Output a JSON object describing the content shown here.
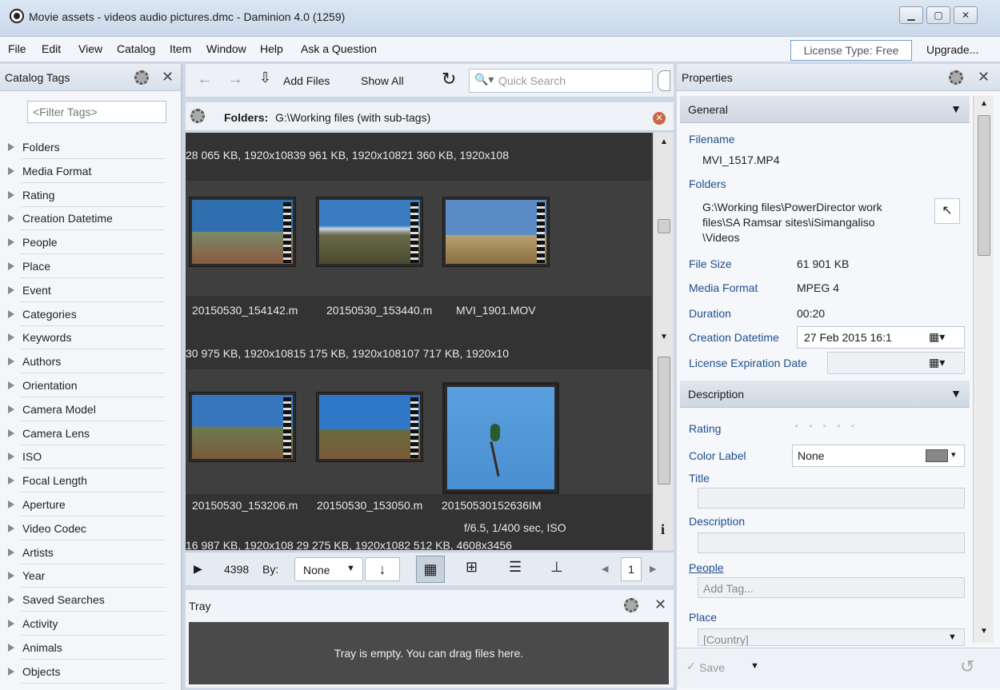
{
  "window": {
    "title": "Movie assets - videos audio pictures.dmc - Daminion 4.0 (1259)"
  },
  "menu": {
    "items": [
      "File",
      "Edit",
      "View",
      "Catalog",
      "Item",
      "Window",
      "Help",
      "Ask a Question"
    ],
    "license": "License Type: Free",
    "upgrade": "Upgrade..."
  },
  "left_panel": {
    "title": "Catalog Tags",
    "filter_placeholder": "<Filter Tags>",
    "tags": [
      "Folders",
      "Media Format",
      "Rating",
      "Creation Datetime",
      "People",
      "Place",
      "Event",
      "Categories",
      "Keywords",
      "Authors",
      "Orientation",
      "Camera Model",
      "Camera Lens",
      "ISO",
      "Focal Length",
      "Aperture",
      "Video Codec",
      "Artists",
      "Year",
      "Saved Searches",
      "Activity",
      "Animals",
      "Objects"
    ]
  },
  "toolbar": {
    "add_files": "Add Files",
    "show_all": "Show All",
    "search_placeholder": "Quick Search"
  },
  "folderbar": {
    "label": "Folders:",
    "path": "G:\\Working files (with sub-tags)"
  },
  "grid": {
    "row1_top": "28 065 KB, 1920x10839 961 KB, 1920x10821 360 KB, 1920x108",
    "row1_names": [
      "20150530_154142.m",
      "20150530_153440.m",
      "MVI_1901.MOV"
    ],
    "row2_top": "30 975 KB, 1920x10815 175 KB, 1920x108107 717 KB, 1920x10",
    "row2_names": [
      "20150530_153206.m",
      "20150530_153050.m",
      "20150530152636IM"
    ],
    "row2_extra": "f/6.5, 1/400 sec, ISO",
    "row3_top": "16 987 KB, 1920x108 29 275 KB, 1920x1082 512 KB, 4608x3456"
  },
  "bottom": {
    "count": "4398",
    "by": "By:",
    "sort": "None",
    "page": "1"
  },
  "tray": {
    "title": "Tray",
    "empty": "Tray is empty. You can drag files here."
  },
  "properties": {
    "title": "Properties",
    "general": "General",
    "filename_label": "Filename",
    "filename": "MVI_1517.MP4",
    "folders_label": "Folders",
    "folders_value": "G:\\Working files\\PowerDirector work files\\SA Ramsar sites\\iSimangaliso \\Videos",
    "filesize_label": "File Size",
    "filesize": "61 901 KB",
    "mediaformat_label": "Media Format",
    "mediaformat": "MPEG 4",
    "duration_label": "Duration",
    "duration": "00:20",
    "creation_label": "Creation Datetime",
    "creation_value": "27  Feb  2015  16:1",
    "license_label": "License Expiration Date",
    "description": "Description",
    "rating_label": "Rating",
    "color_label": "Color Label",
    "color_value": "None",
    "title_label": "Title",
    "desc_label": "Description",
    "people_label": "People",
    "add_tag": "Add Tag...",
    "place_label": "Place",
    "country": "[Country]",
    "save": "Save"
  }
}
